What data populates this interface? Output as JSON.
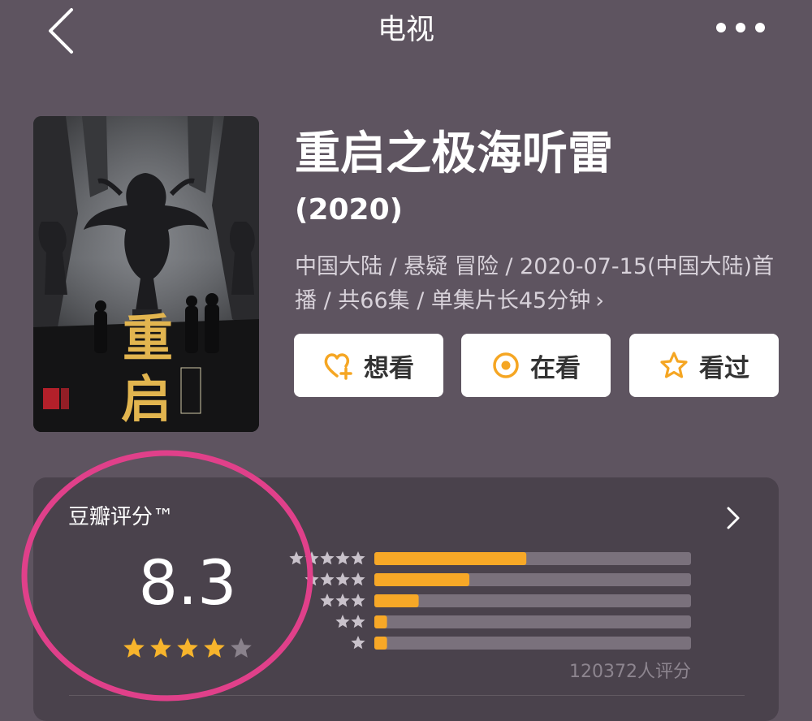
{
  "nav": {
    "title": "电视",
    "back_icon": "chevron-left-icon",
    "more_icon": "more-dots-icon"
  },
  "movie": {
    "title": "重启之极海听雷",
    "year": "(2020)",
    "meta": "中国大陆 / 悬疑 冒险 / 2020-07-15(中国大陆)首播 / 共66集 / 单集片长45分钟",
    "meta_chevron": "›",
    "poster_text": "重启"
  },
  "actions": [
    {
      "label": "想看",
      "icon": "heart-plus-icon"
    },
    {
      "label": "在看",
      "icon": "target-circle-icon"
    },
    {
      "label": "看过",
      "icon": "star-outline-icon"
    }
  ],
  "rating": {
    "label": "豆瓣评分™",
    "score": "8.3",
    "stars_filled": 4,
    "stars_total": 5,
    "count_text": "120372人评分",
    "distribution": [
      {
        "stars": 5,
        "fraction": 0.48
      },
      {
        "stars": 4,
        "fraction": 0.3
      },
      {
        "stars": 3,
        "fraction": 0.14
      },
      {
        "stars": 2,
        "fraction": 0.04
      },
      {
        "stars": 1,
        "fraction": 0.04
      }
    ]
  },
  "colors": {
    "background": "#5e5460",
    "card": "#4a424c",
    "star": "#f7b42c",
    "bar_fill": "#f7a827",
    "bar_track": "#7a717c",
    "highlight_circle": "#e0408a"
  }
}
